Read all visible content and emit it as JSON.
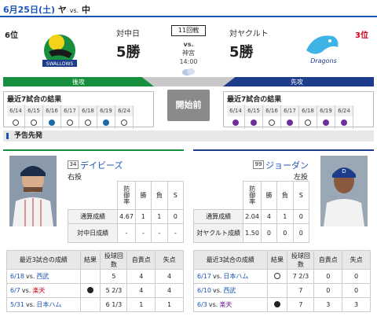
{
  "header": {
    "date": "6月25日(土)",
    "home_team": "ヤ",
    "vs": "vs.",
    "away_team": "中"
  },
  "game": {
    "number_label": "11回戦",
    "vs": "vs.",
    "stadium": "神宮",
    "time": "14:00",
    "weather": "cloudy-icon"
  },
  "swallows": {
    "rank": "6位",
    "vs_label": "対中日",
    "wins": "5勝",
    "logo_text": "SWALLOWS",
    "bar_label": "後攻",
    "last7_title": "最近7試合の結果",
    "dates": [
      "6/14",
      "6/15",
      "6/16",
      "6/17",
      "6/18",
      "6/19",
      "6/24"
    ],
    "results": [
      "lose",
      "lose",
      "win",
      "lose",
      "lose",
      "win",
      "lose"
    ]
  },
  "dragons": {
    "rank": "3位",
    "vs_label": "対ヤクルト",
    "wins": "5勝",
    "logo_text": "Dragons",
    "bar_label": "先攻",
    "last7_title": "最近7試合の結果",
    "dates": [
      "6/14",
      "6/15",
      "6/16",
      "6/17",
      "6/18",
      "6/19",
      "6/24"
    ],
    "results": [
      "win",
      "win",
      "lose",
      "win",
      "lose",
      "win",
      "win"
    ]
  },
  "start_button": "開始前",
  "section_title": "予告先発",
  "pitcher_home": {
    "number": "34",
    "name": "デイビーズ",
    "hand": "右投",
    "stats_headers": [
      "防御率",
      "勝",
      "負",
      "S"
    ],
    "rows": [
      {
        "label": "通算成績",
        "era": "4.67",
        "w": "1",
        "l": "1",
        "s": "0"
      },
      {
        "label": "対中日成績",
        "era": "-",
        "w": "-",
        "l": "-",
        "s": "-"
      }
    ],
    "recent_headers": [
      "最近3試合の成績",
      "結果",
      "投球回数",
      "自責点",
      "失点"
    ],
    "recent": [
      {
        "date": "6/18",
        "vs": "vs.",
        "opp": "西武",
        "result": "",
        "ip": "5",
        "er": "4",
        "r": "4",
        "opp_color": "blue"
      },
      {
        "date": "6/7",
        "vs": "vs.",
        "opp": "楽天",
        "result": "lose",
        "ip": "5 2/3",
        "er": "4",
        "r": "4",
        "opp_color": "red"
      },
      {
        "date": "5/31",
        "vs": "vs.",
        "opp": "日本ハム",
        "result": "",
        "ip": "6 1/3",
        "er": "1",
        "r": "1",
        "opp_color": "blue"
      }
    ]
  },
  "pitcher_away": {
    "number": "99",
    "name": "ジョーダン",
    "hand": "左投",
    "stats_headers": [
      "防御率",
      "勝",
      "負",
      "S"
    ],
    "rows": [
      {
        "label": "通算成績",
        "era": "2.04",
        "w": "4",
        "l": "1",
        "s": "0"
      },
      {
        "label": "対ヤクルト成績",
        "era": "1.50",
        "w": "0",
        "l": "0",
        "s": "0"
      }
    ],
    "recent_headers": [
      "最近3試合の成績",
      "結果",
      "投球回数",
      "自責点",
      "失点"
    ],
    "recent": [
      {
        "date": "6/17",
        "vs": "vs.",
        "opp": "日本ハム",
        "result": "win",
        "ip": "7 2/3",
        "er": "0",
        "r": "0",
        "opp_color": "blue"
      },
      {
        "date": "6/10",
        "vs": "vs.",
        "opp": "西武",
        "result": "",
        "ip": "7",
        "er": "0",
        "r": "0",
        "opp_color": "blue"
      },
      {
        "date": "6/3",
        "vs": "vs.",
        "opp": "楽天",
        "result": "lose",
        "ip": "7",
        "er": "3",
        "r": "3",
        "opp_color": "purple"
      }
    ]
  }
}
